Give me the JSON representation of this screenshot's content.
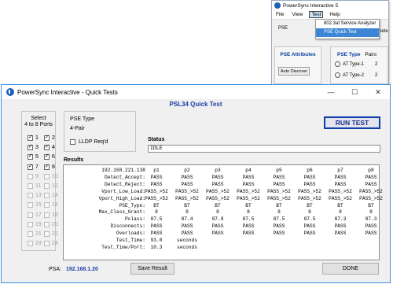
{
  "inset": {
    "title": "PowerSync Interactive 5",
    "menu": [
      "File",
      "View",
      "Test",
      "Help"
    ],
    "active_menu": "Test",
    "dropdown": [
      "802.3af Service Analyzer",
      "PSE Quick Test"
    ],
    "tab_label": "PSE",
    "tab_right": "neters",
    "attributes_title": "PSE Attributes",
    "auto_discover": "Auto Discover",
    "pse_type_title": "PSE Type",
    "pairs": "Pairs",
    "radios": [
      "AT Type-1",
      "AT Type-2"
    ],
    "radio_suffix": [
      "2",
      "2"
    ]
  },
  "window": {
    "title": "PowerSync Interactive - Quick Tests",
    "subtitle": "PSL34 Quick Test",
    "controls": {
      "minimize": "—",
      "maximize": "☐",
      "close": "✕"
    }
  },
  "ports": {
    "header": [
      "Select",
      "4 to 8 Ports"
    ],
    "items": [
      {
        "n": "1",
        "checked": true,
        "enabled": true
      },
      {
        "n": "2",
        "checked": true,
        "enabled": true
      },
      {
        "n": "3",
        "checked": true,
        "enabled": true
      },
      {
        "n": "4",
        "checked": true,
        "enabled": true
      },
      {
        "n": "5",
        "checked": true,
        "enabled": true
      },
      {
        "n": "6",
        "checked": true,
        "enabled": true
      },
      {
        "n": "7",
        "checked": true,
        "enabled": true
      },
      {
        "n": "8",
        "checked": true,
        "enabled": true
      },
      {
        "n": "9",
        "checked": false,
        "enabled": false
      },
      {
        "n": "10",
        "checked": false,
        "enabled": false
      },
      {
        "n": "11",
        "checked": false,
        "enabled": false
      },
      {
        "n": "12",
        "checked": false,
        "enabled": false
      },
      {
        "n": "13",
        "checked": false,
        "enabled": false
      },
      {
        "n": "14",
        "checked": false,
        "enabled": false
      },
      {
        "n": "15",
        "checked": false,
        "enabled": false
      },
      {
        "n": "16",
        "checked": false,
        "enabled": false
      },
      {
        "n": "17",
        "checked": false,
        "enabled": false
      },
      {
        "n": "18",
        "checked": false,
        "enabled": false
      },
      {
        "n": "19",
        "checked": false,
        "enabled": false
      },
      {
        "n": "20",
        "checked": false,
        "enabled": false
      },
      {
        "n": "21",
        "checked": false,
        "enabled": false
      },
      {
        "n": "22",
        "checked": false,
        "enabled": false
      },
      {
        "n": "23",
        "checked": false,
        "enabled": false
      },
      {
        "n": "24",
        "checked": false,
        "enabled": false
      }
    ]
  },
  "pse_type": {
    "title": "PSE Type",
    "value": "4-Pair",
    "lldp_label": "LLDP Req'd",
    "lldp_checked": false
  },
  "run_test": "RUN TEST",
  "status": {
    "label": "Status",
    "value": "IDLE"
  },
  "results": {
    "label": "Results",
    "ip": "192.168.221.138",
    "columns": [
      "p1",
      "p2",
      "p3",
      "p4",
      "p5",
      "p6",
      "p7",
      "p8"
    ],
    "rows": [
      {
        "label": "Detect_Accept:",
        "values": [
          "PASS",
          "PASS",
          "PASS",
          "PASS",
          "PASS",
          "PASS",
          "PASS",
          "PASS"
        ]
      },
      {
        "label": "Detect_Reject:",
        "values": [
          "PASS",
          "PASS",
          "PASS",
          "PASS",
          "PASS",
          "PASS",
          "PASS",
          "PASS"
        ]
      },
      {
        "label": "Vport_Low_Load:",
        "values": [
          "PASS_>52",
          "PASS_>52",
          "PASS_>52",
          "PASS_>52",
          "PASS_>52",
          "PASS_>52",
          "PASS_>52",
          "PASS_>52"
        ]
      },
      {
        "label": "Vport_High_Load:",
        "values": [
          "PASS_>52",
          "PASS_>52",
          "PASS_>52",
          "PASS_>52",
          "PASS_>52",
          "PASS_>52",
          "PASS_>52",
          "PASS_>52"
        ]
      },
      {
        "label": "PSE_Type:",
        "values": [
          "BT",
          "BT",
          "BT",
          "BT",
          "BT",
          "BT",
          "BT",
          "BT"
        ]
      },
      {
        "label": "Max_Class_Grant:",
        "values": [
          "8",
          "8",
          "8",
          "8",
          "8",
          "8",
          "8",
          "8"
        ]
      },
      {
        "label": "Pclass:",
        "values": [
          "87.5",
          "87.4",
          "87.8",
          "87.5",
          "87.5",
          "87.5",
          "87.3",
          "87.3"
        ]
      },
      {
        "label": "Disconnects:",
        "values": [
          "PASS",
          "PASS",
          "PASS",
          "PASS",
          "PASS",
          "PASS",
          "PASS",
          "PASS"
        ]
      },
      {
        "label": "Overloads:",
        "values": [
          "PASS",
          "PASS",
          "PASS",
          "PASS",
          "PASS",
          "PASS",
          "PASS",
          "PASS"
        ]
      }
    ],
    "test_time": {
      "label": "Test_Time:",
      "value": "93.0",
      "unit": "seconds"
    },
    "test_time_port": {
      "label": "Test_Time/Port:",
      "value": "10.3",
      "unit": "seconds"
    }
  },
  "footer": {
    "psa_label": "PSA:",
    "psa_value": "192.168.1.20",
    "save_result": "Save Result",
    "done": "DONE"
  }
}
